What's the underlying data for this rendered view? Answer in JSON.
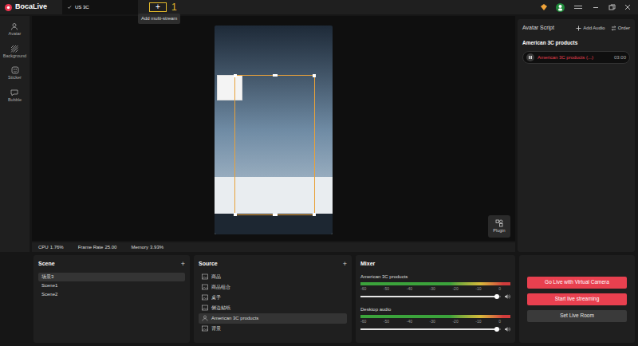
{
  "app": {
    "name": "BocaLive"
  },
  "tabs": [
    {
      "label": "US 3C",
      "selected": true
    }
  ],
  "add_tab": {
    "label": "+",
    "annotation": "1",
    "tooltip": "Add multi-stream"
  },
  "sidebar": {
    "items": [
      {
        "label": "Avatar",
        "kind": "avatar"
      },
      {
        "label": "Background",
        "kind": "background"
      },
      {
        "label": "Sticker",
        "kind": "sticker"
      },
      {
        "label": "Bubble",
        "kind": "bubble"
      }
    ]
  },
  "canvas": {
    "plugin": "Plugin"
  },
  "stats": [
    {
      "label": "CPU",
      "value": "1.76%"
    },
    {
      "label": "Frame Rate",
      "value": "25.00"
    },
    {
      "label": "Memory",
      "value": "3.93%"
    }
  ],
  "script": {
    "title": "Avatar Script",
    "add_audio": "Add Audio",
    "order": "Order",
    "group": "American 3C products",
    "items": [
      {
        "label": "American 3C products (...)",
        "duration": "03:00",
        "playing": true
      }
    ]
  },
  "scene": {
    "title": "Scene",
    "add": "+",
    "items": [
      {
        "label": "场景3",
        "selected": true
      },
      {
        "label": "Scene1",
        "selected": false
      },
      {
        "label": "Scene2",
        "selected": false
      }
    ]
  },
  "source": {
    "title": "Source",
    "add": "+",
    "items": [
      {
        "label": "商品",
        "selected": false,
        "kind": "image"
      },
      {
        "label": "商品组合",
        "selected": false,
        "kind": "image"
      },
      {
        "label": "桌子",
        "selected": false,
        "kind": "image"
      },
      {
        "label": "侧边贴纸",
        "selected": false,
        "kind": "image"
      },
      {
        "label": "American 3C products",
        "selected": true,
        "kind": "avatar"
      },
      {
        "label": "背景",
        "selected": false,
        "kind": "image"
      }
    ]
  },
  "mixer": {
    "title": "Mixer",
    "ticks": [
      "-60",
      "-50",
      "-40",
      "-30",
      "-20",
      "-10",
      "0"
    ],
    "channels": [
      {
        "name": "American 3C products",
        "level": 0.97,
        "muted": false
      },
      {
        "name": "Desktop audio",
        "level": 0.97,
        "muted": false
      }
    ]
  },
  "actions": [
    {
      "label": "Go Live with Virtual Camera",
      "kind": "primary"
    },
    {
      "label": "Start live streaming",
      "kind": "primary"
    },
    {
      "label": "Set Live Room",
      "kind": "secondary"
    }
  ]
}
